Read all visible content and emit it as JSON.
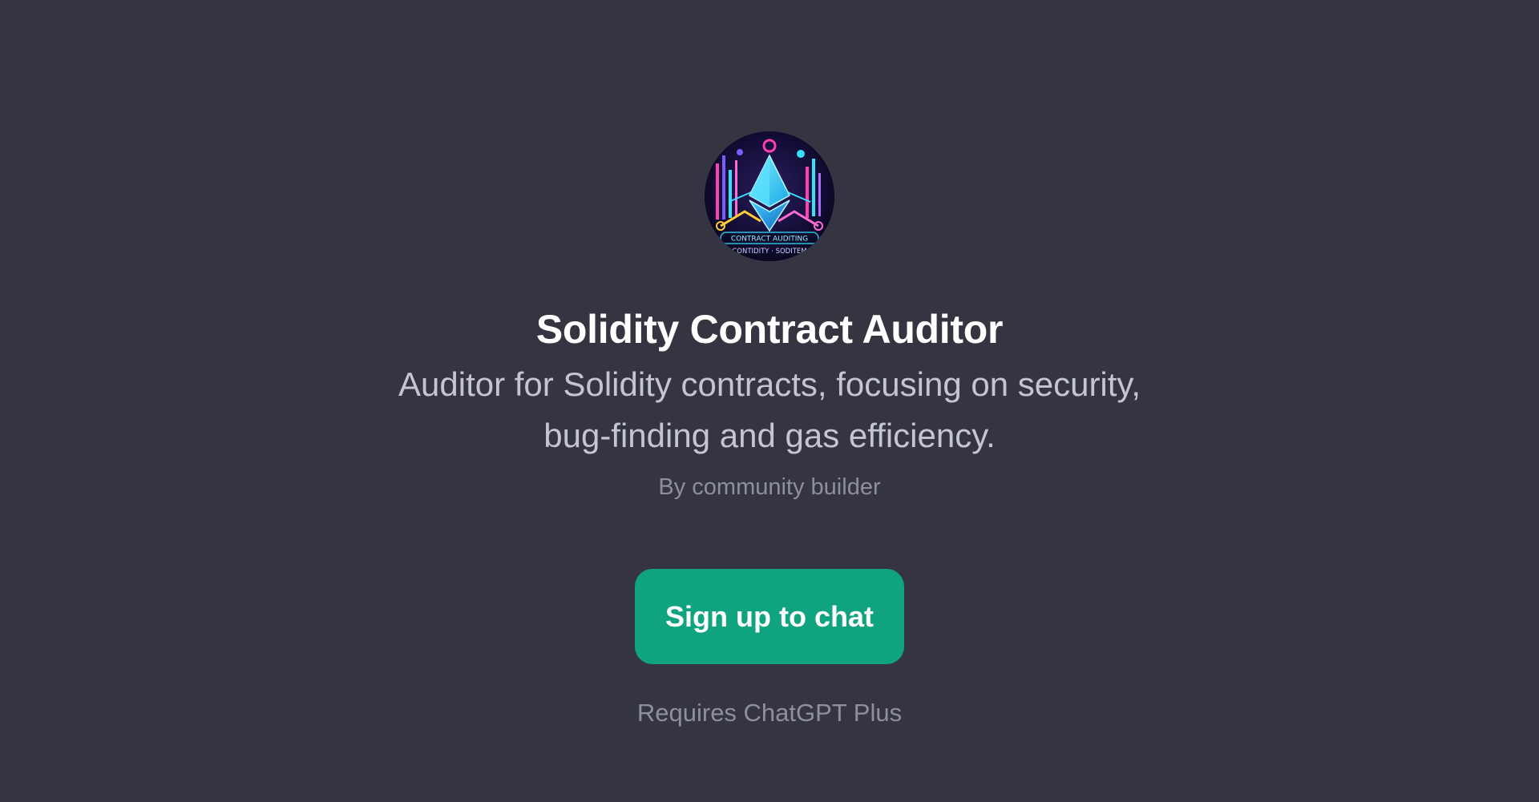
{
  "gpt": {
    "avatar_icon": "ethereum-contract-auditing-logo-icon",
    "avatar_text_line1": "CONTRACT AUDITING",
    "avatar_text_line2": "CONTIDITY · SODITEM",
    "title": "Solidity Contract Auditor",
    "description": "Auditor for Solidity contracts, focusing on security, bug-finding and gas efficiency.",
    "byline": "By community builder"
  },
  "cta": {
    "signup_label": "Sign up to chat",
    "requires_note": "Requires ChatGPT Plus"
  },
  "colors": {
    "background": "#343541",
    "title": "#ffffff",
    "description": "#c5c5d2",
    "muted": "#8e8ea0",
    "button": "#10a37f",
    "button_text": "#ffffff"
  }
}
